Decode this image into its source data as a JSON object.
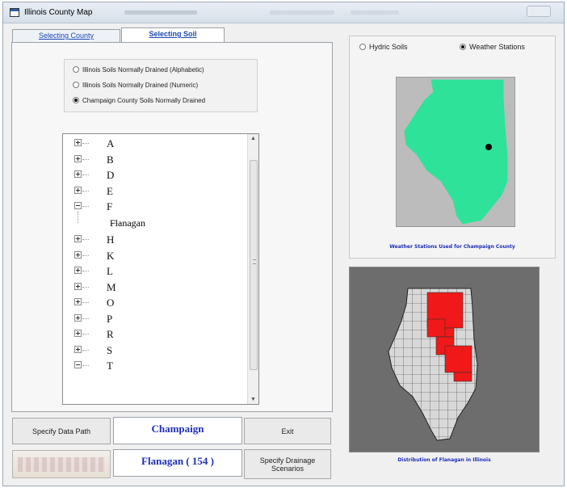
{
  "window": {
    "title": "Illinois County Map"
  },
  "tabs": [
    {
      "label": "Selecting County",
      "active": false
    },
    {
      "label": "Selecting Soil",
      "active": true
    }
  ],
  "soil_options": [
    {
      "label": "Illinois Soils Normally Drained (Alphabetic)",
      "selected": false
    },
    {
      "label": "Illinois Soils Normally Drained (Numeric)",
      "selected": false
    },
    {
      "label": "Champaign County Soils Normally Drained",
      "selected": true
    }
  ],
  "soil_tree": {
    "items": [
      {
        "label": "A",
        "expanded": false
      },
      {
        "label": "B",
        "expanded": false
      },
      {
        "label": "D",
        "expanded": false
      },
      {
        "label": "E",
        "expanded": false
      },
      {
        "label": "F",
        "expanded": true
      },
      {
        "label": "H",
        "expanded": false
      },
      {
        "label": "K",
        "expanded": false
      },
      {
        "label": "L",
        "expanded": false
      },
      {
        "label": "M",
        "expanded": false
      },
      {
        "label": "O",
        "expanded": false
      },
      {
        "label": "P",
        "expanded": false
      },
      {
        "label": "R",
        "expanded": false
      },
      {
        "label": "S",
        "expanded": false
      },
      {
        "label": "T",
        "expanded": true
      }
    ],
    "f_child": "Flanagan"
  },
  "buttons": {
    "data_path": "Specify Data Path",
    "exit": "Exit",
    "drainage": "Specify Drainage Scenarios"
  },
  "county_display": "Champaign",
  "soil_display": "Flanagan ( 154 )",
  "map_options": [
    {
      "label": "Hydric Soils",
      "selected": false
    },
    {
      "label": "Weather Stations",
      "selected": true
    }
  ],
  "captions": {
    "weather": "Weather Stations Used for Champaign County",
    "distribution": "Distribution of Flanagan in Illinois"
  },
  "colors": {
    "state_fill": "#2ee29a",
    "station_marker": "#000000",
    "county_highlight": "#f01818",
    "county_fill": "#d8d8d8",
    "caption_text": "#1c2fb5"
  }
}
